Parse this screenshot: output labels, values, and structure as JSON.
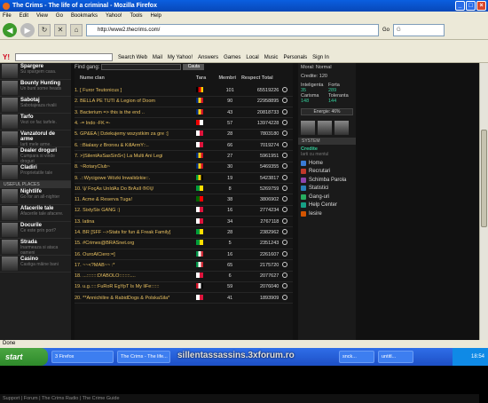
{
  "window": {
    "title": "The Crims - The life of a criminal - Mozilla Firefox"
  },
  "menu": [
    "File",
    "Edit",
    "View",
    "Go",
    "Bookmarks",
    "Yahoo!",
    "Tools",
    "Help"
  ],
  "nav": {
    "url": "http://www2.thecrims.com/",
    "go_label": "Go"
  },
  "yahoo": {
    "brand": "Y!",
    "buttons": [
      "Search Web",
      "Mail",
      "My Yahoo!",
      "Answers",
      "Games",
      "Local",
      "Music",
      "Personals",
      "Sign In"
    ]
  },
  "sidebar": {
    "items": [
      {
        "title": "Spargere",
        "sub": "Su spargem casa."
      },
      {
        "title": "Bounty Hunting",
        "sub": "Un bunt some heads"
      },
      {
        "title": "Sabotaj",
        "sub": "Sabotajeaza rivalii"
      },
      {
        "title": "Tarfo",
        "sub": "Vezi ce fac tarfele."
      },
      {
        "title": "Vanzatorul de arme",
        "sub": "Iarti mele arme."
      },
      {
        "title": "Dealer droguri",
        "sub": "Cumpara si vinde droguri"
      },
      {
        "title": "Cladiri",
        "sub": "Proprietatile tale"
      }
    ],
    "header": "USEFUL PLACES",
    "items2": [
      {
        "title": "Nightlife",
        "sub": "Go for an all-nighter"
      },
      {
        "title": "Afacerile tale",
        "sub": "Afacerile tale afacere."
      },
      {
        "title": "Docurile",
        "sub": "Ce este prín port?"
      },
      {
        "title": "Strada",
        "sub": "Inarmeaza si ataca oameni"
      },
      {
        "title": "Casino",
        "sub": "Castiga mâine bani"
      }
    ]
  },
  "gang": {
    "search_label": "Find gang:",
    "search_button": "Cauta",
    "headers": [
      "Nume clan",
      "Tara",
      "Membri",
      "Respect Total"
    ],
    "rows": [
      {
        "n": "1.",
        "name": "[ Furor Teutonicus ]",
        "flag": "de",
        "members": "101",
        "respect": "65519226"
      },
      {
        "n": "2.",
        "name": "BELLA PE TUTI & Legion of Doom",
        "flag": "ro",
        "members": "90",
        "respect": "22958895"
      },
      {
        "n": "3.",
        "name": "Bacterium => this is the end ..",
        "flag": "ro",
        "members": "43",
        "respect": "20818733"
      },
      {
        "n": "4.",
        "name": "-= Indo -FK =-",
        "flag": "id",
        "members": "57",
        "respect": "13974228"
      },
      {
        "n": "5.",
        "name": "GP&EA | Dziekujemy wszystkim za gre :]",
        "flag": "pl",
        "members": "28",
        "respect": "7803180"
      },
      {
        "n": "6.",
        "name": "::Bialasy z Bronxu & KillArmY::..",
        "flag": "pl",
        "members": "66",
        "respect": "7019274"
      },
      {
        "n": "7.",
        "name": ">)SilentAsSasSinS<) La Multi Ani Legi",
        "flag": "ro",
        "members": "27",
        "respect": "5961951"
      },
      {
        "n": "8.",
        "name": "~RotaryClub~",
        "flag": "ro",
        "members": "30",
        "respect": "5469355"
      },
      {
        "n": "9.",
        "name": ".::Wycigowe Wózki Inwalidzkie::.",
        "flag": "jm",
        "members": "19",
        "respect": "5423817"
      },
      {
        "n": "10.",
        "name": "\\|/ FoçAs UnIdAs Do BrAsIl ®©\\|/",
        "flag": "br",
        "members": "8",
        "respect": "5269759"
      },
      {
        "n": "11.",
        "name": "Acme & Reserva Tuga!",
        "flag": "pt",
        "members": "38",
        "respect": "3806902"
      },
      {
        "n": "12.",
        "name": "SixtySix GANG :)",
        "flag": "pl",
        "members": "16",
        "respect": "2774234"
      },
      {
        "n": "13.",
        "name": "latina",
        "flag": "pl",
        "members": "34",
        "respect": "2767118"
      },
      {
        "n": "14.",
        "name": "BR [SFF -->Stats for fun & Freak Family]",
        "flag": "br",
        "members": "28",
        "respect": "2382962"
      },
      {
        "n": "15.",
        "name": "#Crimes@BRASnet.org",
        "flag": "br",
        "members": "5",
        "respect": "2351243"
      },
      {
        "n": "16.",
        "name": "OuroAlCiero:=]",
        "flag": "it",
        "members": "16",
        "respect": "2261607"
      },
      {
        "n": "17.",
        "name": "~~<?MAB~~ :*",
        "flag": "it",
        "members": "65",
        "respect": "2175720"
      },
      {
        "n": "18.",
        "name": "...::::::::D!ABOLO::::::::....",
        "flag": "pl",
        "members": "6",
        "respect": "2077627"
      },
      {
        "n": "19.",
        "name": "u.g.:::::FuRoR EgYpT Is My liFe::::::",
        "flag": "eg",
        "members": "59",
        "respect": "2076040"
      },
      {
        "n": "20.",
        "name": "**Annichilire & RabidDogs & PolskaSila*",
        "flag": "pl",
        "members": "41",
        "respect": "1893909"
      }
    ]
  },
  "right": {
    "stats_top": [
      "Moral:",
      "Normal"
    ],
    "credits_label": "Credite: 120",
    "stats": [
      {
        "k": "Inteligenta",
        "v": "35"
      },
      {
        "k": "Forta",
        "v": "289"
      },
      {
        "k": "Carisma",
        "v": "148"
      },
      {
        "k": "Toleranta",
        "v": "144"
      }
    ],
    "energy": "Energie: 46%",
    "section_header": "SYSTEM",
    "credite_title": "Credite",
    "credite_sub": "Iarti cu mentul",
    "links": [
      "Home",
      "Recrutari",
      "Schimba Parola",
      "Statistici",
      "Gang-uri",
      "Help Center",
      "Iesire"
    ]
  },
  "footer": "Support | Forum | The Crims Radio | The Crime Guide",
  "status": "Done",
  "taskbar": {
    "start": "start",
    "items": [
      "3 Firefox",
      "The Crims - The life...",
      "snck...",
      "untitl..."
    ],
    "overlay": "sillentassassins.3xforum.ro",
    "time": "18:54"
  }
}
